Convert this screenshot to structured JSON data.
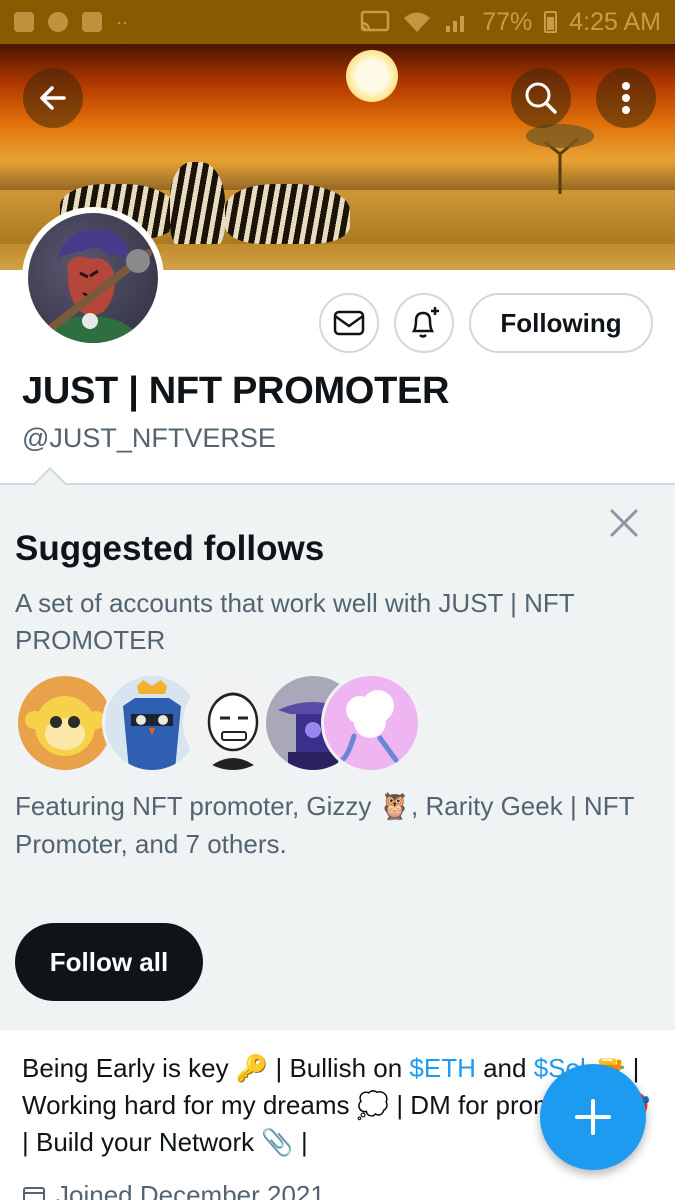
{
  "status_bar": {
    "battery": "77%",
    "time": "4:25 AM",
    "background_color": "#8a5a00"
  },
  "header": {
    "back_icon": "arrow-left-icon",
    "search_icon": "search-icon",
    "more_icon": "more-vertical-icon"
  },
  "profile": {
    "name": "JUST | NFT PROMOTER",
    "handle": "@JUST_NFTVERSE",
    "message_icon": "mail-icon",
    "notify_icon": "bell-plus-icon",
    "following_label": "Following"
  },
  "suggested": {
    "title": "Suggested follows",
    "description": "A set of accounts that work well with JUST | NFT PROMOTER",
    "featuring": "Featuring NFT promoter, Gizzy 🦉, Rarity Geek | NFT Promoter, and 7 others.",
    "follow_all_label": "Follow all",
    "close_icon": "close-icon",
    "avatars": [
      "monkey-avatar",
      "owl-avatar",
      "ape-avatar",
      "robot-avatar",
      "cloud-avatar"
    ]
  },
  "bio": {
    "part1": "Being Early is key 🔑 | Bullish on ",
    "eth": "$ETH",
    "part2": " and ",
    "sol": "$Sol",
    "part3": " 🔫 | Working hard for my dreams 💭 | DM for promotion 🎯 | Build your Network 📎 |",
    "joined": "Joined December 2021"
  },
  "fab": {
    "icon": "plus-icon",
    "color": "#1d9bf0"
  }
}
